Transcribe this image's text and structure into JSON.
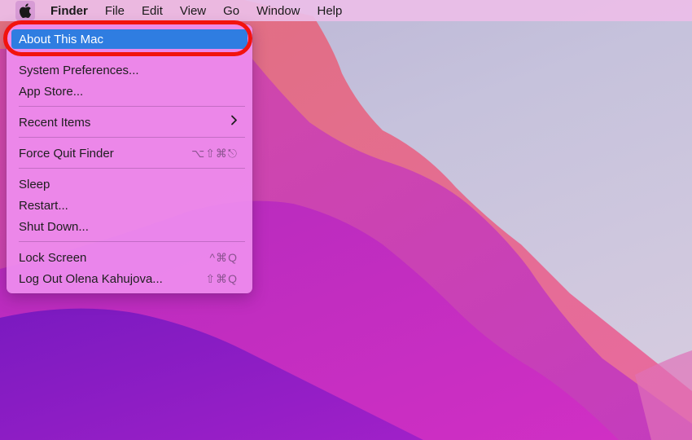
{
  "menubar": {
    "apple_icon": "apple-logo-icon",
    "items": [
      {
        "label": "Finder",
        "bold": true
      },
      {
        "label": "File"
      },
      {
        "label": "Edit"
      },
      {
        "label": "View"
      },
      {
        "label": "Go"
      },
      {
        "label": "Window"
      },
      {
        "label": "Help"
      }
    ]
  },
  "apple_menu": {
    "items": [
      {
        "label": "About This Mac",
        "highlighted": true
      },
      {
        "label": "System Preferences..."
      },
      {
        "label": "App Store..."
      },
      {
        "label": "Recent Items",
        "submenu_icon": "chevron-right-icon"
      },
      {
        "label": "Force Quit Finder",
        "shortcut": "⌥⇧⌘⎋"
      },
      {
        "label": "Sleep"
      },
      {
        "label": "Restart..."
      },
      {
        "label": "Shut Down..."
      },
      {
        "label": "Lock Screen",
        "shortcut": "^⌘Q"
      },
      {
        "label": "Log Out Olena Kahujova...",
        "shortcut": "⇧⌘Q"
      }
    ]
  },
  "colors": {
    "highlight": "#2f7de1",
    "callout": "#f2130e"
  }
}
